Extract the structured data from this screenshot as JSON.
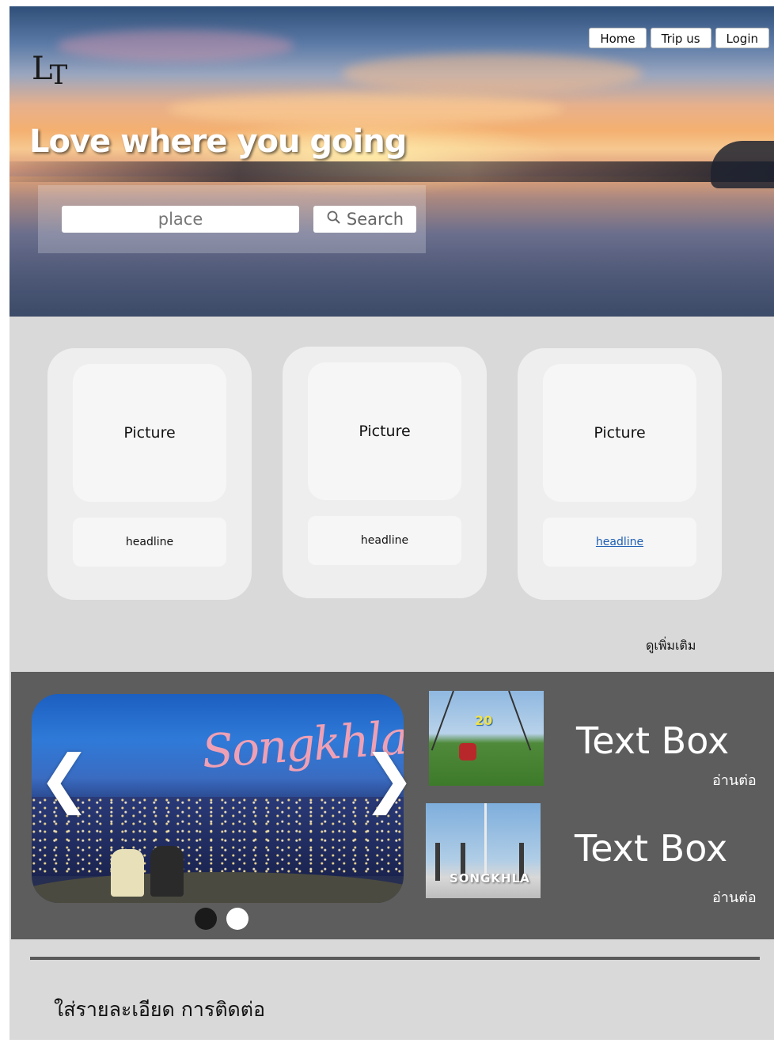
{
  "header": {
    "logo_text": "LT",
    "logo_l": "L",
    "logo_t": "T",
    "tagline": "Love where you going",
    "nav": [
      {
        "label": "Home"
      },
      {
        "label": "Trip us"
      },
      {
        "label": "Login"
      }
    ],
    "search": {
      "placeholder": "place",
      "button_label": "Search"
    }
  },
  "cards": [
    {
      "picture_label": "Picture",
      "headline": "headline"
    },
    {
      "picture_label": "Picture",
      "headline": "headline"
    },
    {
      "picture_label": "Picture",
      "headline": "headline"
    }
  ],
  "more_link": "ดูเพิ่มเติม",
  "featured": {
    "slide_script_text": "Songkhla",
    "prev_arrow": "❮",
    "next_arrow": "❯",
    "active_dot": 0,
    "dot_count": 2,
    "items": [
      {
        "title": "Text Box",
        "read_more": "อ่านต่อ"
      },
      {
        "title": "Text Box",
        "read_more": "อ่านต่อ"
      }
    ],
    "thumb1_badge": "20",
    "thumb2_sign": "SONGKHLA"
  },
  "footer": {
    "contact_text": "ใส่รายละเอียด การติดต่อ"
  },
  "colors": {
    "page_bg": "#d9d9d9",
    "featured_bg": "#5d5d5d",
    "card_bg": "#eeeeee",
    "card_inner_bg": "#f6f6f6",
    "link_color": "#1f5fb3",
    "dot_active": "#1a1a1a",
    "dot_inactive": "#ffffff"
  }
}
